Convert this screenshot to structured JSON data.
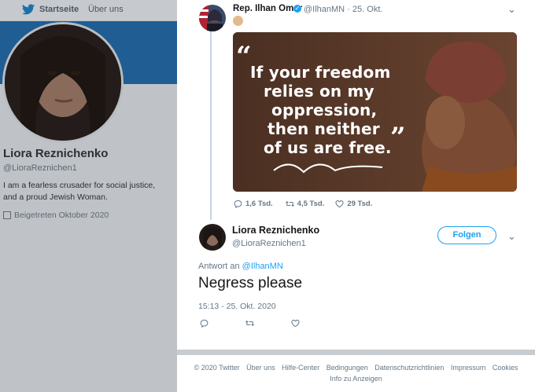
{
  "topbar": {
    "home_label": "Startseite",
    "about_label": "Über uns"
  },
  "profile": {
    "name": "Liora Reznichenko",
    "handle": "@LioraReznichen1",
    "bio": "I am a fearless crusader for social justice, and a proud Jewish Woman.",
    "joined": "Beigetreten Oktober 2020"
  },
  "tweet1": {
    "name": "Rep. Ilhan Omar",
    "handle": "@IlhanMN",
    "date": "· 25. Okt.",
    "quote_lines": [
      "If your freedom",
      "relies on my",
      "oppression,",
      "then neither",
      "of us are free."
    ],
    "quote_open": "“",
    "quote_close": "”",
    "replies": "1,6 Tsd.",
    "retweets": "4,5 Tsd.",
    "likes": "29 Tsd."
  },
  "tweet2": {
    "name": "Liora Reznichenko",
    "handle": "@LioraReznichen1",
    "follow_label": "Folgen",
    "reply_prefix": "Antwort an",
    "reply_handle": "@IlhanMN",
    "text": "Negress please",
    "timestamp": "15:13 - 25. Okt. 2020"
  },
  "footer": {
    "links": [
      "© 2020 Twitter",
      "Über uns",
      "Hilfe-Center",
      "Bedingungen",
      "Datenschutzrichtlinien",
      "Impressum",
      "Cookies",
      "Info zu Anzeigen"
    ]
  },
  "colors": {
    "accent": "#1da1f2",
    "banner": "#1f5d93"
  },
  "icons": [
    "twitter-bird-icon",
    "verified-icon",
    "reply-icon",
    "retweet-icon",
    "like-icon",
    "chevron-down-icon",
    "calendar-icon"
  ]
}
